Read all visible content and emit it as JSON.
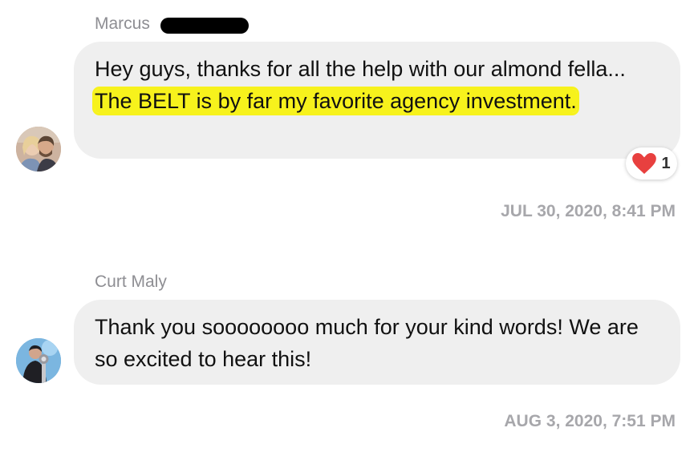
{
  "messages": [
    {
      "sender": "Marcus",
      "text_plain": "Hey guys, thanks for all the help with our almond fella...",
      "text_highlighted": "The BELT is by far my favorite agency investment.",
      "reaction": {
        "icon": "heart-icon",
        "count": "1"
      },
      "timestamp": "JUL 30, 2020, 8:41 PM"
    },
    {
      "sender": "Curt Maly",
      "text": "Thank you soooooooo much for your kind words! We are so excited to hear this!",
      "timestamp": "AUG 3, 2020, 7:51 PM"
    }
  ],
  "colors": {
    "bubble": "#efefef",
    "highlight": "#f7f21c",
    "sender": "#8e8e93",
    "timestamp": "#a7a7ab",
    "heart": "#e8403f"
  }
}
